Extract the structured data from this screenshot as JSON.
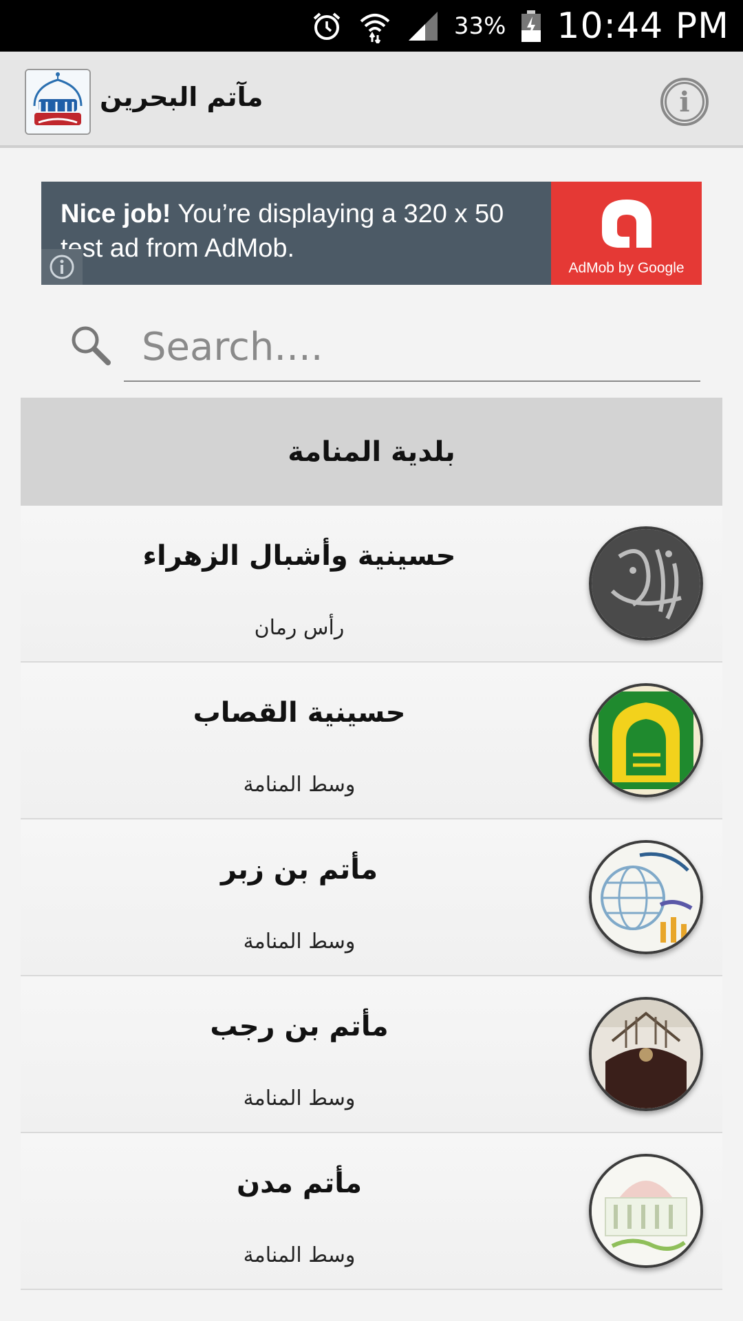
{
  "status_bar": {
    "battery": "33%",
    "time": "10:44 PM",
    "icons": [
      "alarm-icon",
      "wifi-icon",
      "signal-icon",
      "battery-icon"
    ]
  },
  "app_bar": {
    "title": "مآتم البحرين",
    "logo_icon": "app-logo",
    "info_icon": "info-icon"
  },
  "ad": {
    "headline_bold": "Nice job!",
    "headline_rest": " You’re displaying a 320 x 50 test ad from AdMob.",
    "brand": "AdMob by Google",
    "colors": {
      "left": "#4c5a66",
      "right": "#e53935"
    }
  },
  "search": {
    "placeholder": "Search...."
  },
  "section": {
    "title": "بلدية المنامة"
  },
  "items": [
    {
      "title": "حسينية وأشبال الزهراء",
      "subtitle": "رأس رمان",
      "avatar": "alzahraa-logo"
    },
    {
      "title": "حسينية القصاب",
      "subtitle": "وسط المنامة",
      "avatar": "alqassab-logo"
    },
    {
      "title": "مأتم بن زبر",
      "subtitle": "وسط المنامة",
      "avatar": "bin-zubr-logo"
    },
    {
      "title": "مأتم بن رجب",
      "subtitle": "وسط المنامة",
      "avatar": "bin-rajab-photo"
    },
    {
      "title": "مأتم مدن",
      "subtitle": "وسط المنامة",
      "avatar": "madan-logo"
    }
  ]
}
